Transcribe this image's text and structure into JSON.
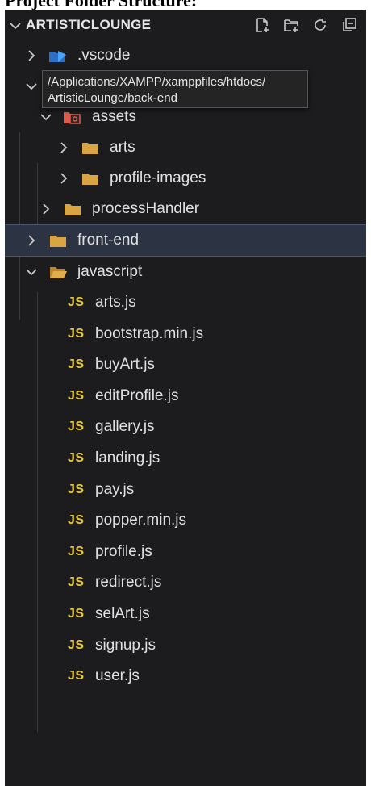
{
  "page_heading": "Project Folder Structure:",
  "explorer": {
    "title": "ARTISTICLOUNGE",
    "actions": [
      {
        "name": "new-file-icon"
      },
      {
        "name": "new-folder-icon"
      },
      {
        "name": "refresh-icon"
      },
      {
        "name": "collapse-all-icon"
      }
    ]
  },
  "tooltip": {
    "line1": "/Applications/XAMPP/xamppfiles/htdocs/",
    "line2": "ArtisticLounge/back-end"
  },
  "tree": {
    "vscode": ".vscode",
    "assets": "assets",
    "arts": "arts",
    "profile_images": "profile-images",
    "processHandler": "processHandler",
    "front_end": "front-end",
    "javascript": "javascript"
  },
  "js_badge": "JS",
  "js_files": [
    "arts.js",
    "bootstrap.min.js",
    "buyArt.js",
    "editProfile.js",
    "gallery.js",
    "landing.js",
    "pay.js",
    "popper.min.js",
    "profile.js",
    "redirect.js",
    "selArt.js",
    "signup.js",
    "user.js"
  ],
  "colors": {
    "panel_bg": "#1c1c1e",
    "folder": "#d9a441",
    "js_badge": "#e8c93a",
    "vscode_icon": "#3b82d6",
    "assets_icon": "#e05a4a",
    "selection_bg": "#2c3444"
  }
}
